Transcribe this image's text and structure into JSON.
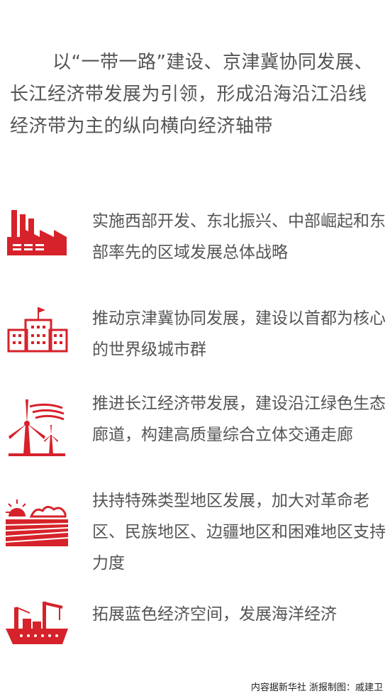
{
  "intro": "以“一带一路”建设、京津冀协同发展、长江经济带发展为引领，形成沿海沿江沿线经济带为主的纵向横向经济轴带",
  "items": [
    {
      "icon": "factory-icon",
      "text": "实施西部开发、东北振兴、中部崛起和东部率先的区域发展总体战略"
    },
    {
      "icon": "city-building-icon",
      "text": "推动京津冀协同发展，建设以首都为核心的世界级城市群"
    },
    {
      "icon": "wind-turbine-icon",
      "text": "推进长江经济带发展，建设沿江绿色生态廊道，构建高质量综合立体交通走廊"
    },
    {
      "icon": "farmland-sun-icon",
      "text": "扶持特殊类型地区发展，加大对革命老区、民族地区、边疆地区和困难地区支持力度"
    },
    {
      "icon": "cargo-ship-icon",
      "text": "拓展蓝色经济空间，发展海洋经济"
    }
  ],
  "credit": "内容据新华社  浙报制图：戚建卫",
  "colors": {
    "accent": "#d6222a",
    "text": "#555555"
  }
}
